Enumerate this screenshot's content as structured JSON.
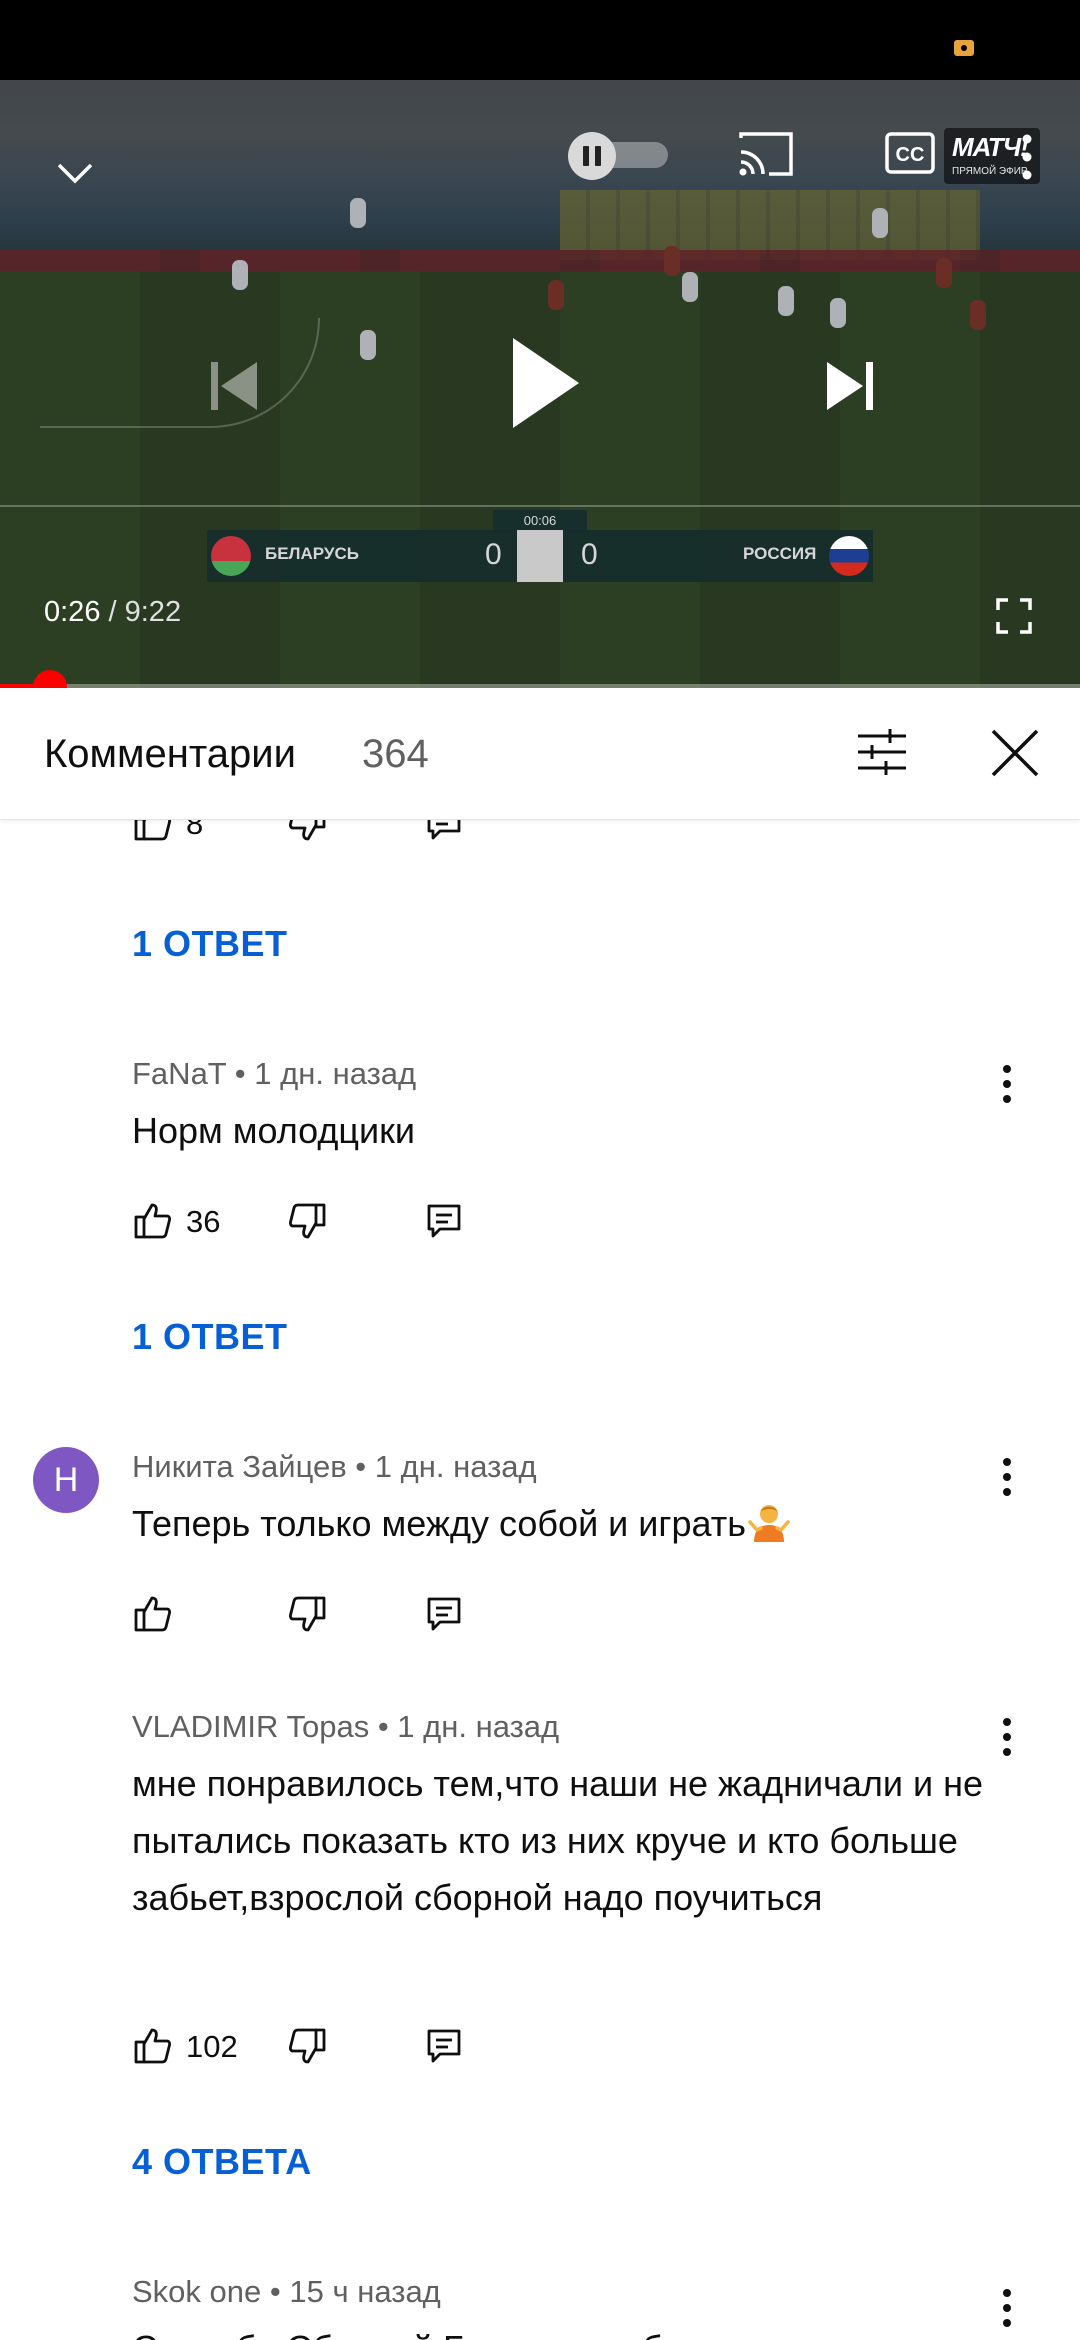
{
  "player": {
    "current_time": "0:26",
    "separator": " / ",
    "duration": "9:22",
    "progress_fraction": 0.046,
    "channel_logo": "МАТЧ!",
    "channel_logo_sub": "ПРЯМОЙ ЭФИР",
    "scoreboard": {
      "clock": "00:06",
      "home_team": "БЕЛАРУСЬ",
      "home_score": "0",
      "away_score": "0",
      "away_team": "РОССИЯ"
    },
    "icons": {
      "minimize": "chevron-down-icon",
      "autoplay": "pause-toggle-icon",
      "cast": "cast-icon",
      "captions": "cc-icon",
      "more": "more-vert-icon",
      "previous": "skip-previous-icon",
      "play": "play-icon",
      "next": "skip-next-icon",
      "fullscreen": "fullscreen-icon"
    }
  },
  "comments_panel": {
    "title": "Комментарии",
    "count": "364",
    "icons": {
      "filter": "sort-filter-icon",
      "close": "close-icon"
    }
  },
  "comments": [
    {
      "partial": true,
      "likes": "8",
      "replies_label": "1 ОТВЕТ"
    },
    {
      "author": "FaNaT",
      "time": "1 дн. назад",
      "text": "Норм молодцики",
      "likes": "36",
      "replies_label": "1 ОТВЕТ"
    },
    {
      "author": "Никита Зайцев",
      "time": "1 дн. назад",
      "avatar_letter": "Н",
      "avatar_color": "#7e57c2",
      "text": "Теперь только между собой и играть",
      "emoji": "person-shrugging-emoji",
      "likes": ""
    },
    {
      "author": "VLADIMIR Topas",
      "time": "1 дн. назад",
      "text": "мне понравилось тем,что наши не жадничали и не пытались показать кто из них круче и кто больше забьет,взрослой сборной надо поучиться",
      "likes": "102",
      "replies_label": "4 ОТВЕТА"
    },
    {
      "author": "Skok one",
      "time": "15 ч назад",
      "text": "Спасибо Сборной Беларуси и болельщикам за"
    }
  ],
  "colors": {
    "accent_link": "#065fd4",
    "progress": "#ff0000",
    "meta_text": "#606060"
  }
}
